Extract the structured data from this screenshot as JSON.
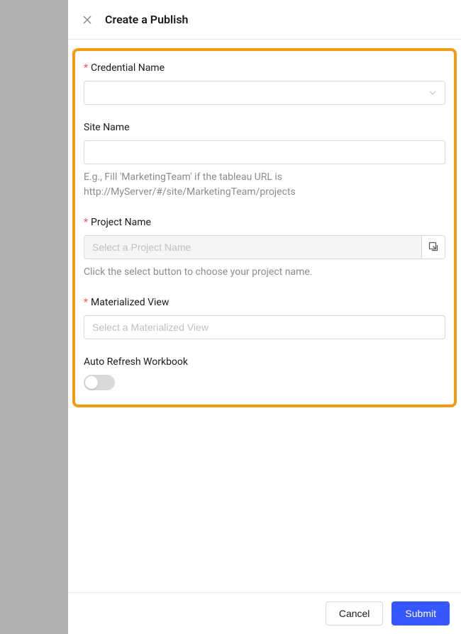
{
  "header": {
    "title": "Create a Publish"
  },
  "fields": {
    "credential": {
      "label": "Credential Name",
      "required": true,
      "value": ""
    },
    "site": {
      "label": "Site Name",
      "required": false,
      "value": "",
      "hint": "E.g., Fill 'MarketingTeam' if the tableau URL is http://MyServer/#/site/MarketingTeam/projects"
    },
    "project": {
      "label": "Project Name",
      "required": true,
      "placeholder": "Select a Project Name",
      "hint": "Click the select button to choose your project name."
    },
    "matview": {
      "label": "Materialized View",
      "required": true,
      "placeholder": "Select a Materialized View"
    },
    "autorefresh": {
      "label": "Auto Refresh Workbook",
      "value": false
    }
  },
  "footer": {
    "cancel": "Cancel",
    "submit": "Submit"
  }
}
